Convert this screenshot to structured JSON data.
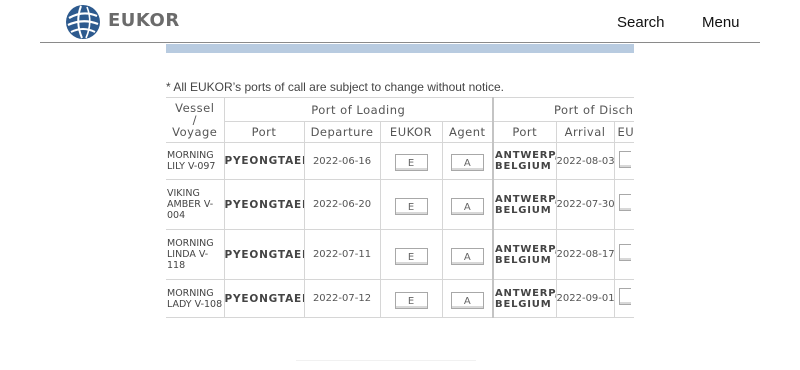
{
  "header": {
    "brand": "EUKOR",
    "search_label": "Search",
    "menu_label": "Menu"
  },
  "notice": "* All EUKOR’s ports of call are subject to change without notice.",
  "table": {
    "vessel_header": [
      "Vessel",
      "/",
      "Voyage"
    ],
    "loading_group": "Port of Loading",
    "discharge_group": "Port of Discha",
    "sub_headers": {
      "port": "Port",
      "departure": "Departure",
      "eukor": "EUKOR",
      "agent": "Agent",
      "dport": "Port",
      "arrival": "Arrival",
      "eu": "EU"
    },
    "rows": [
      {
        "vessel": "MORNING LILY V-097",
        "port": "PYEONGTAEK",
        "departure": "2022-06-16",
        "eukor": "E",
        "agent": "A",
        "dport": "ANTWERP, BELGIUM",
        "arrival": "2022-08-03"
      },
      {
        "vessel": "VIKING AMBER V-004",
        "port": "PYEONGTAEK",
        "departure": "2022-06-20",
        "eukor": "E",
        "agent": "A",
        "dport": "ANTWERP, BELGIUM",
        "arrival": "2022-07-30"
      },
      {
        "vessel": "MORNING LINDA V-118",
        "port": "PYEONGTAEK",
        "departure": "2022-07-11",
        "eukor": "E",
        "agent": "A",
        "dport": "ANTWERP, BELGIUM",
        "arrival": "2022-08-17"
      },
      {
        "vessel": "MORNING LADY V-108",
        "port": "PYEONGTAEK",
        "departure": "2022-07-12",
        "eukor": "E",
        "agent": "A",
        "dport": "ANTWERP, BELGIUM",
        "arrival": "2022-09-01"
      }
    ]
  },
  "colors": {
    "band": "#b8cbe0",
    "logo": "#2d5a8e"
  }
}
